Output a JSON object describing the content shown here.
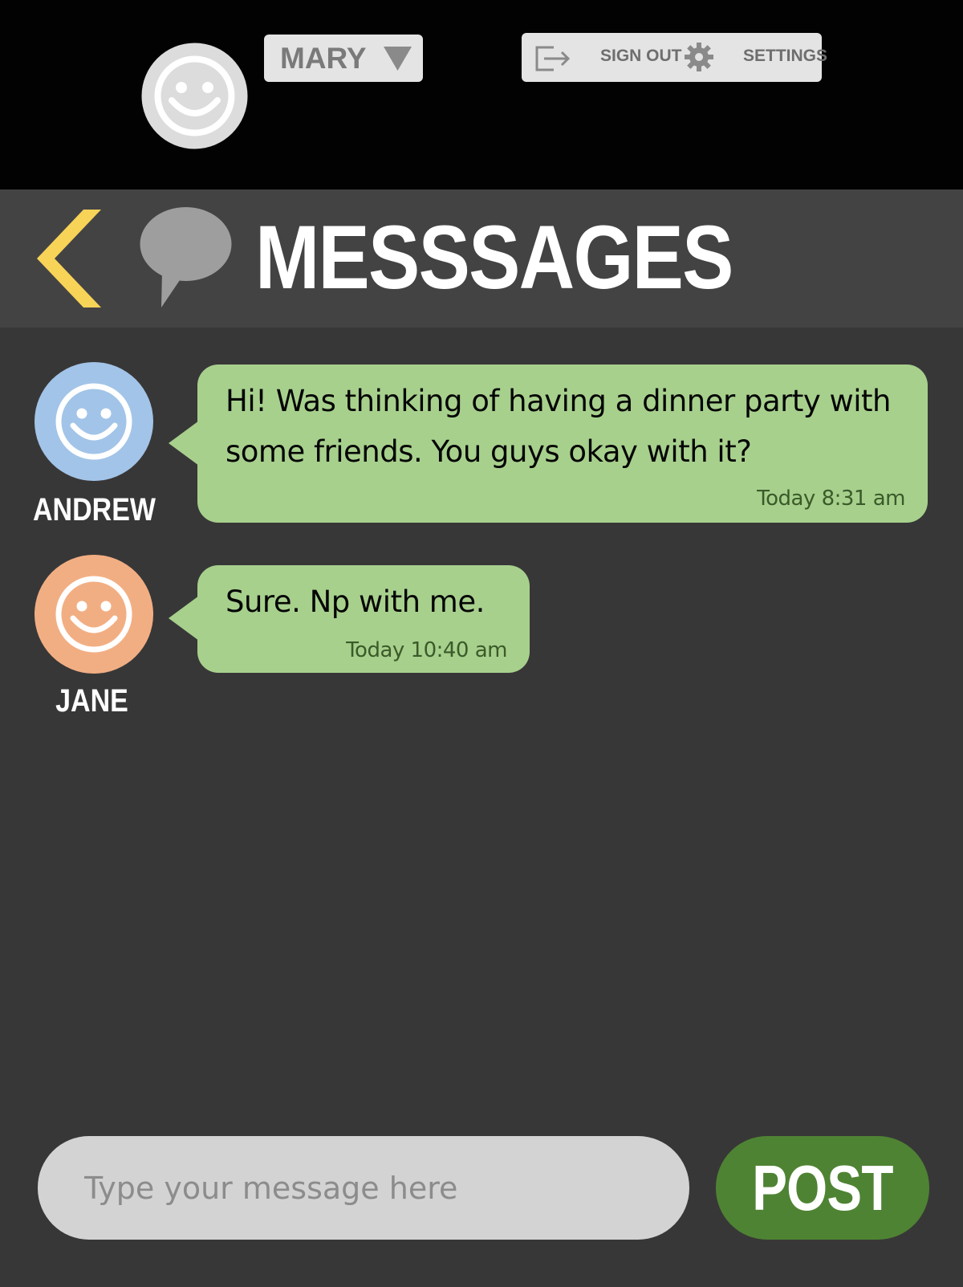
{
  "header": {
    "current_user": "MARY",
    "sign_out_label": "SIGN OUT",
    "settings_label": "SETTINGS"
  },
  "titlebar": {
    "title": "MESSSAGES"
  },
  "messages": [
    {
      "sender": "ANDREW",
      "avatar_color": "#a2c4e8",
      "text_lines": [
        "Hi! Was thinking of having a dinner party with",
        "some friends. You guys okay with it?"
      ],
      "time": "Today 8:31 am"
    },
    {
      "sender": "JANE",
      "avatar_color": "#f2ae83",
      "text_lines": [
        "Sure. Np with me."
      ],
      "time": "Today 10:40 am"
    }
  ],
  "composer": {
    "placeholder": "Type your message here",
    "post_label": "POST"
  },
  "colors": {
    "bubble": "#a7d08d",
    "post_button": "#4e8333",
    "back_arrow": "#f7d358",
    "background": "#383737"
  },
  "icons": {
    "user_avatar": "smiley-icon",
    "sign_out": "sign-out-icon",
    "settings": "gear-icon",
    "back": "chevron-left-icon",
    "messages": "speech-bubble-icon",
    "dropdown": "triangle-down-icon"
  }
}
